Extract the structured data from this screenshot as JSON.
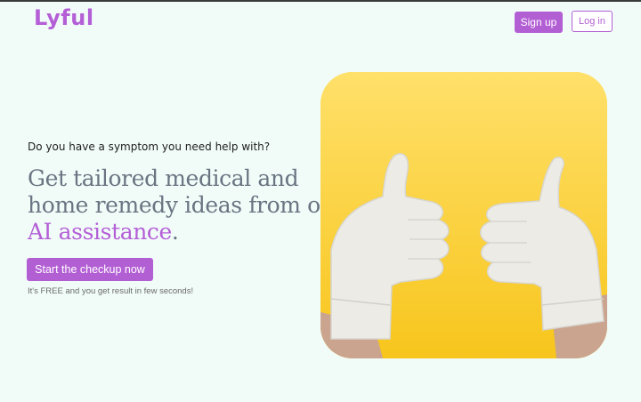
{
  "header": {
    "logo": "Lyful",
    "signup_label": "Sign up",
    "login_label": "Log in"
  },
  "hero": {
    "question": "Do you have a symptom you need help with?",
    "headline_line1": "Get tailored medical and",
    "headline_line2": "home remedy ideas from our",
    "headline_accent": "AI assistance",
    "headline_period": ".",
    "cta_label": "Start the checkup now",
    "note": "It's FREE and you get result in few seconds!"
  },
  "image": {
    "subject": "two hands in white medical gloves giving thumbs up on yellow background"
  },
  "colors": {
    "brand": "#b35fd4",
    "background": "#f1fcf9",
    "headline": "#6a7482"
  }
}
